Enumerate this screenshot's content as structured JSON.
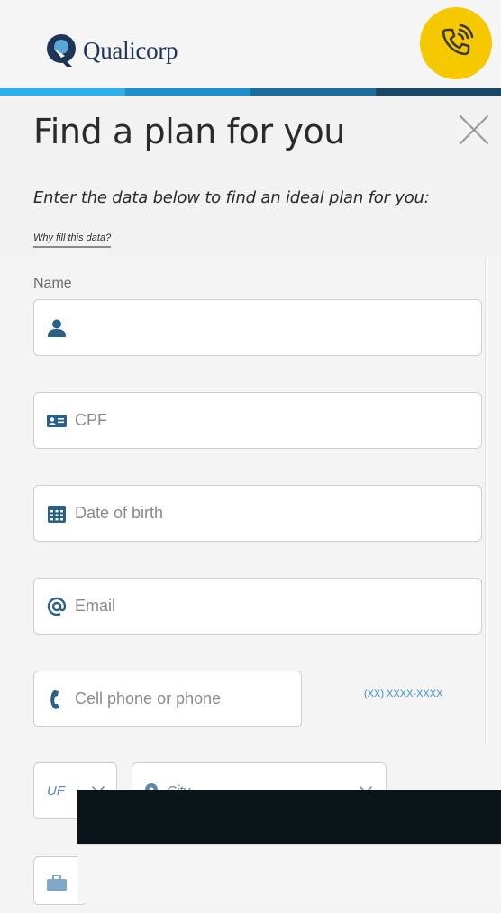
{
  "header": {
    "logo_text": "Qualicorp",
    "call_icon": "phone-ringing-icon",
    "colors": {
      "accent_yellow": "#f5c800",
      "brand_navy": "#1e3556"
    }
  },
  "stripe_colors": [
    "#2db1e8",
    "#1f8fc9",
    "#1b6c9c",
    "#174966"
  ],
  "modal": {
    "title": "Find a plan for you",
    "subtitle": "Enter the data below to find an ideal plan for you:",
    "why_link": "Why fill this data?",
    "close_icon": "close-icon"
  },
  "form": {
    "name_label": "Name",
    "name": {
      "value": "",
      "placeholder": "",
      "icon": "user-icon"
    },
    "cpf": {
      "placeholder": "CPF",
      "icon": "id-card-icon"
    },
    "dob": {
      "placeholder": "Date of birth",
      "icon": "calendar-icon"
    },
    "email": {
      "placeholder": "Email",
      "icon": "at-icon"
    },
    "phone": {
      "placeholder": "Cell phone or phone",
      "icon": "phone-icon",
      "hint": "(XX) XXXX-XXXX"
    },
    "uf": {
      "value": "UF",
      "icon": "chevron-down-icon"
    },
    "city": {
      "value": "City",
      "icon": "map-pin-icon"
    }
  }
}
